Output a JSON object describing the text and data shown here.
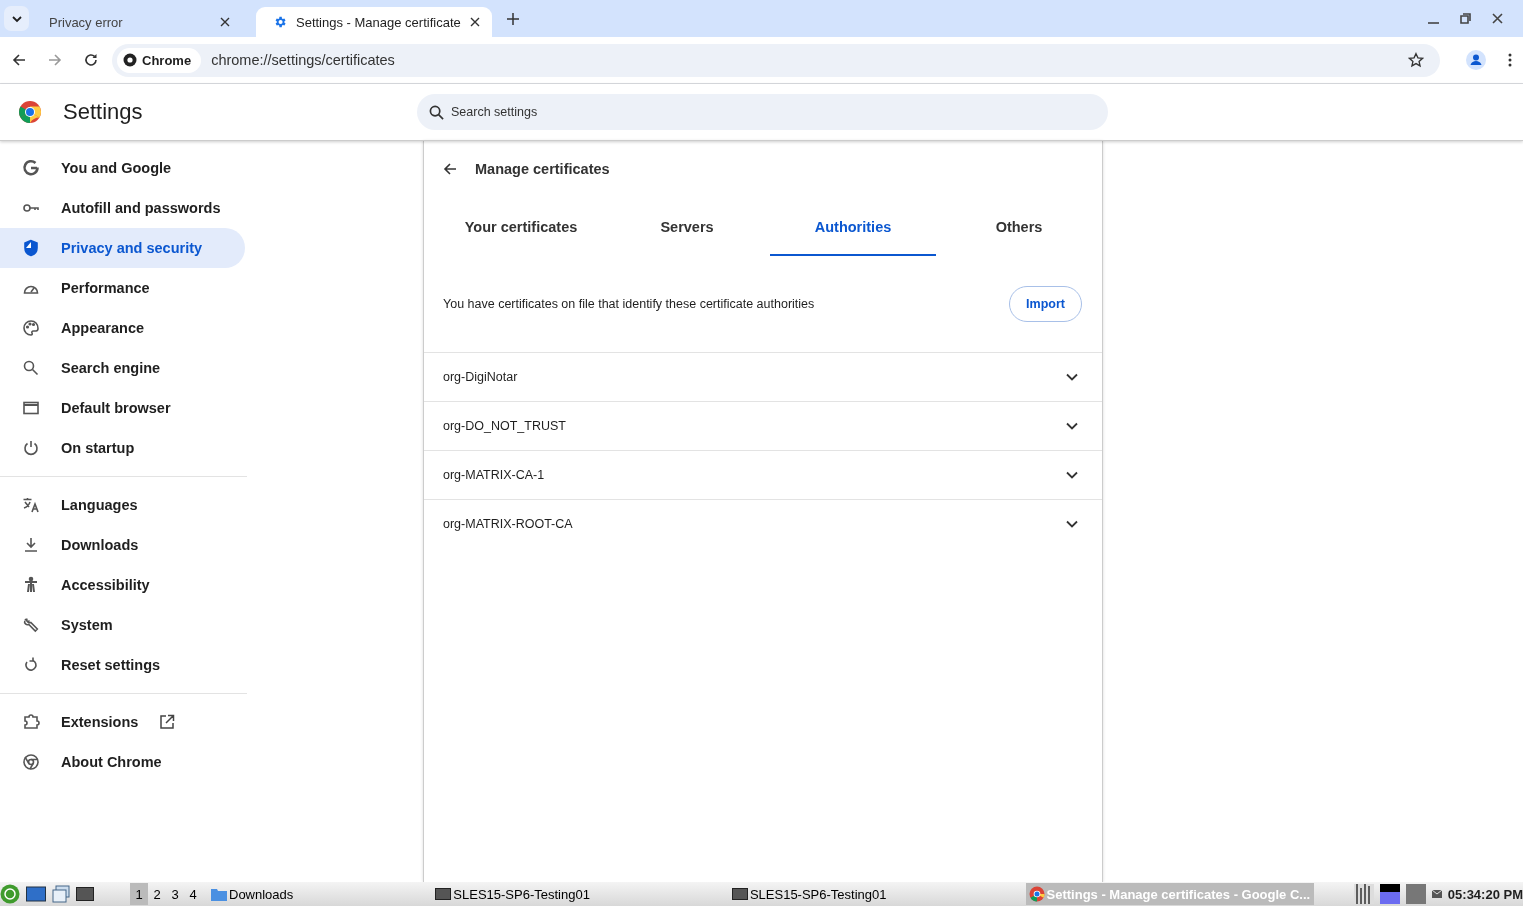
{
  "browser_tabs": [
    {
      "title": "Privacy error",
      "selected": false
    },
    {
      "title": "Settings - Manage certificate",
      "selected": true
    }
  ],
  "address_bar": {
    "chip": "Chrome",
    "url": "chrome://settings/certificates"
  },
  "header": {
    "title": "Settings",
    "search": {
      "placeholder": "Search settings"
    }
  },
  "sidebar": {
    "groups": [
      {
        "items": [
          {
            "label": "You and Google",
            "selected": false
          },
          {
            "label": "Autofill and passwords",
            "selected": false
          },
          {
            "label": "Privacy and security",
            "selected": true
          },
          {
            "label": "Performance",
            "selected": false
          },
          {
            "label": "Appearance",
            "selected": false
          },
          {
            "label": "Search engine",
            "selected": false
          },
          {
            "label": "Default browser",
            "selected": false
          },
          {
            "label": "On startup",
            "selected": false
          }
        ]
      },
      {
        "items": [
          {
            "label": "Languages",
            "selected": false
          },
          {
            "label": "Downloads",
            "selected": false
          },
          {
            "label": "Accessibility",
            "selected": false
          },
          {
            "label": "System",
            "selected": false
          },
          {
            "label": "Reset settings",
            "selected": false
          }
        ]
      },
      {
        "items": [
          {
            "label": "Extensions",
            "selected": false
          },
          {
            "label": "About Chrome",
            "selected": false
          }
        ]
      }
    ]
  },
  "panel": {
    "title": "Manage certificates",
    "tabs": [
      {
        "label": "Your certificates",
        "selected": false
      },
      {
        "label": "Servers",
        "selected": false
      },
      {
        "label": "Authorities",
        "selected": true
      },
      {
        "label": "Others",
        "selected": false
      }
    ],
    "description": "You have certificates on file that identify these certificate authorities",
    "import_button": "Import",
    "authorities": [
      {
        "name": "org-DigiNotar"
      },
      {
        "name": "org-DO_NOT_TRUST"
      },
      {
        "name": "org-MATRIX-CA-1"
      },
      {
        "name": "org-MATRIX-ROOT-CA"
      }
    ]
  },
  "taskbar": {
    "workspaces": [
      {
        "label": "1",
        "selected": true
      },
      {
        "label": "2",
        "selected": false
      },
      {
        "label": "3",
        "selected": false
      },
      {
        "label": "4",
        "selected": false
      }
    ],
    "tasks": [
      {
        "kind": "folder",
        "label": "Downloads",
        "selected": false
      },
      {
        "kind": "window",
        "label": "SLES15-SP6-Testing01",
        "selected": false
      },
      {
        "kind": "window",
        "label": "SLES15-SP6-Testing01",
        "selected": false
      },
      {
        "kind": "browser",
        "label": "Settings - Manage certificates - Google C...",
        "selected": true
      }
    ],
    "clock": "05:34:20 PM"
  }
}
